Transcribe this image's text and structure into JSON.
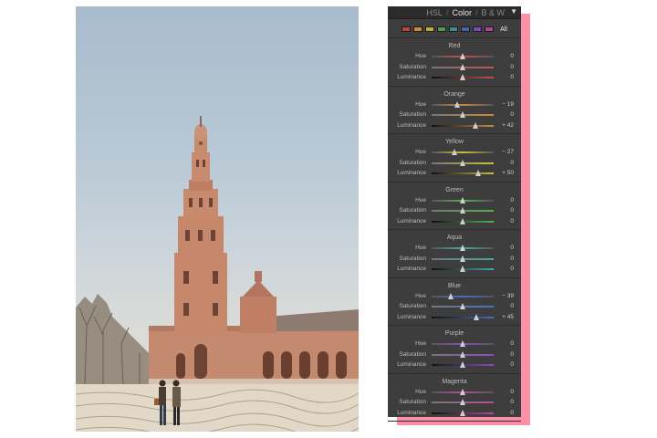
{
  "photo": {
    "alt_subject": "plaza-tower-photo"
  },
  "panel": {
    "tabs": [
      {
        "label": "HSL",
        "active": false
      },
      {
        "label": "Color",
        "active": true
      },
      {
        "label": "B & W",
        "active": false
      }
    ],
    "separator": "/",
    "collapse_icon": "triangle-down-icon",
    "swatches": [
      "#b44646",
      "#c78a3e",
      "#b8ad3e",
      "#4f9a4f",
      "#3f8b8b",
      "#4a62b0",
      "#7b4ab0",
      "#a8468f"
    ],
    "all_label": "All",
    "row_labels": {
      "hue": "Hue",
      "saturation": "Saturation",
      "luminance": "Luminance"
    },
    "groups": [
      {
        "name": "Red",
        "color": "#c0504d",
        "hue": {
          "value": 0,
          "display": "0"
        },
        "saturation": {
          "value": 0,
          "display": "0"
        },
        "luminance": {
          "value": 0,
          "display": "0"
        }
      },
      {
        "name": "Orange",
        "color": "#c98a3a",
        "hue": {
          "value": -19,
          "display": "− 19"
        },
        "saturation": {
          "value": 0,
          "display": "0"
        },
        "luminance": {
          "value": 42,
          "display": "+ 42"
        }
      },
      {
        "name": "Yellow",
        "color": "#c8c03a",
        "hue": {
          "value": -27,
          "display": "− 27"
        },
        "saturation": {
          "value": 0,
          "display": "0"
        },
        "luminance": {
          "value": 50,
          "display": "+ 50"
        }
      },
      {
        "name": "Green",
        "color": "#4fb24f",
        "hue": {
          "value": 0,
          "display": "0"
        },
        "saturation": {
          "value": 0,
          "display": "0"
        },
        "luminance": {
          "value": 0,
          "display": "0"
        }
      },
      {
        "name": "Aqua",
        "color": "#3fa9a3",
        "hue": {
          "value": 0,
          "display": "0"
        },
        "saturation": {
          "value": 0,
          "display": "0"
        },
        "luminance": {
          "value": 0,
          "display": "0"
        }
      },
      {
        "name": "Blue",
        "color": "#4a6cc8",
        "hue": {
          "value": -39,
          "display": "− 39"
        },
        "saturation": {
          "value": 0,
          "display": "0"
        },
        "luminance": {
          "value": 45,
          "display": "+ 45"
        }
      },
      {
        "name": "Purple",
        "color": "#8a4ec0",
        "hue": {
          "value": 0,
          "display": "0"
        },
        "saturation": {
          "value": 0,
          "display": "0"
        },
        "luminance": {
          "value": 0,
          "display": "0"
        }
      },
      {
        "name": "Magenta",
        "color": "#b84a9e",
        "hue": {
          "value": 0,
          "display": "0"
        },
        "saturation": {
          "value": 0,
          "display": "0"
        },
        "luminance": {
          "value": 0,
          "display": "0"
        }
      }
    ]
  }
}
